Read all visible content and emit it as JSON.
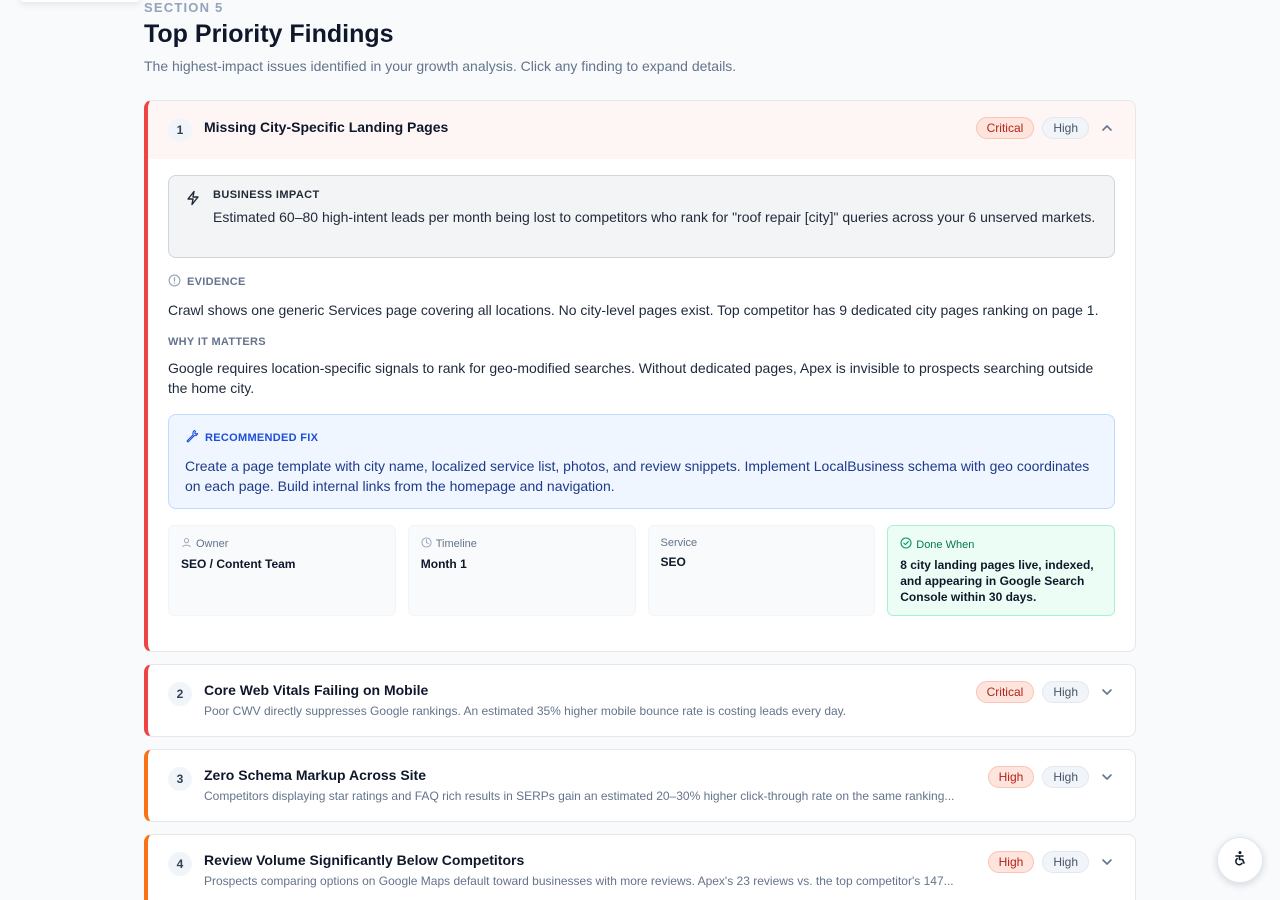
{
  "header": {
    "eyebrow": "SECTION 5",
    "title": "Top Priority Findings",
    "subtitle": "The highest-impact issues identified in your growth analysis. Click any finding to expand details."
  },
  "findings": [
    {
      "number": "1",
      "title": "Missing City-Specific Landing Pages",
      "severity": "Critical",
      "effort": "High",
      "expanded": true,
      "impact_label": "BUSINESS IMPACT",
      "impact_text": "Estimated 60–80 high-intent leads per month being lost to competitors who rank for \"roof repair [city]\" queries across your 6 unserved markets.",
      "evidence_label": "EVIDENCE",
      "evidence_text": "Crawl shows one generic Services page covering all locations. No city-level pages exist. Top competitor has 9 dedicated city pages ranking on page 1.",
      "why_label": "WHY IT MATTERS",
      "why_text": "Google requires location-specific signals to rank for geo-modified searches. Without dedicated pages, Apex is invisible to prospects searching outside the home city.",
      "fix_label": "RECOMMENDED FIX",
      "fix_text": "Create a page template with city name, localized service list, photos, and review snippets. Implement LocalBusiness schema with geo coordinates on each page. Build internal links from the homepage and navigation.",
      "meta": {
        "owner_label": "Owner",
        "owner_value": "SEO / Content Team",
        "timeline_label": "Timeline",
        "timeline_value": "Month 1",
        "service_label": "Service",
        "service_value": "SEO",
        "done_label": "Done When",
        "done_value": "8 city landing pages live, indexed, and appearing in Google Search Console within 30 days."
      }
    },
    {
      "number": "2",
      "title": "Core Web Vitals Failing on Mobile",
      "summary": "Poor CWV directly suppresses Google rankings. An estimated 35% higher mobile bounce rate is costing leads every day.",
      "severity": "Critical",
      "effort": "High"
    },
    {
      "number": "3",
      "title": "Zero Schema Markup Across Site",
      "summary": "Competitors displaying star ratings and FAQ rich results in SERPs gain an estimated 20–30% higher click-through rate on the same ranking...",
      "severity": "High",
      "effort": "High"
    },
    {
      "number": "4",
      "title": "Review Volume Significantly Below Competitors",
      "summary": "Prospects comparing options on Google Maps default toward businesses with more reviews. Apex's 23 reviews vs. the top competitor's 147...",
      "severity": "High",
      "effort": "High"
    }
  ],
  "colors": {
    "critical_border": "#ef4444",
    "high_border": "#f97316"
  },
  "icons": {
    "impact": "lightning-icon",
    "evidence": "alert-circle-icon",
    "fix": "wrench-icon",
    "owner": "user-icon",
    "timeline": "clock-icon",
    "done": "check-circle-icon",
    "expand": "chevron-down-icon",
    "collapse": "chevron-up-icon",
    "accessibility": "accessibility-icon"
  }
}
